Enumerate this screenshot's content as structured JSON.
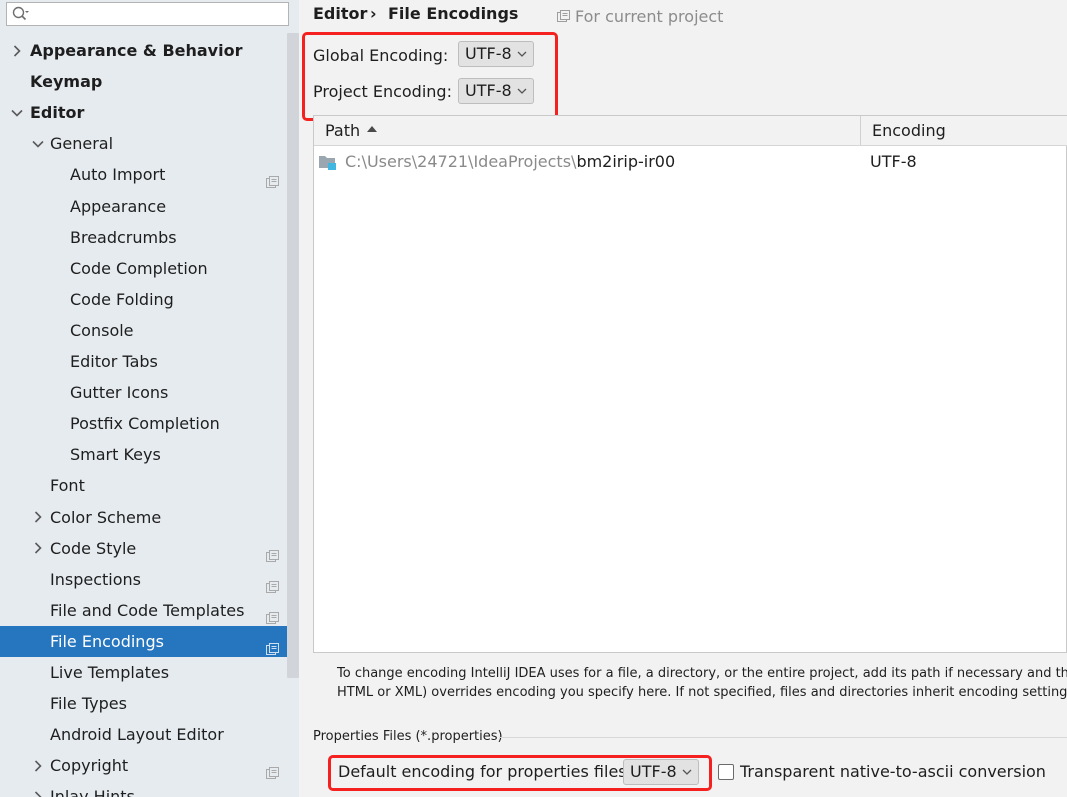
{
  "search": {
    "placeholder": ""
  },
  "tree": [
    {
      "label": "Appearance & Behavior",
      "level": 0,
      "bold": true,
      "chevron": "right"
    },
    {
      "label": "Keymap",
      "level": 0,
      "bold": true,
      "chevron": "none"
    },
    {
      "label": "Editor",
      "level": 0,
      "bold": true,
      "chevron": "down"
    },
    {
      "label": "General",
      "level": 1,
      "chevron": "down"
    },
    {
      "label": "Auto Import",
      "level": 2,
      "project_icon": true
    },
    {
      "label": "Appearance",
      "level": 2
    },
    {
      "label": "Breadcrumbs",
      "level": 2
    },
    {
      "label": "Code Completion",
      "level": 2
    },
    {
      "label": "Code Folding",
      "level": 2
    },
    {
      "label": "Console",
      "level": 2
    },
    {
      "label": "Editor Tabs",
      "level": 2
    },
    {
      "label": "Gutter Icons",
      "level": 2
    },
    {
      "label": "Postfix Completion",
      "level": 2
    },
    {
      "label": "Smart Keys",
      "level": 2
    },
    {
      "label": "Font",
      "level": 1
    },
    {
      "label": "Color Scheme",
      "level": 1,
      "chevron": "right"
    },
    {
      "label": "Code Style",
      "level": 1,
      "chevron": "right",
      "project_icon": true
    },
    {
      "label": "Inspections",
      "level": 1,
      "project_icon": true
    },
    {
      "label": "File and Code Templates",
      "level": 1,
      "project_icon": true
    },
    {
      "label": "File Encodings",
      "level": 1,
      "selected": true,
      "project_icon": true
    },
    {
      "label": "Live Templates",
      "level": 1
    },
    {
      "label": "File Types",
      "level": 1
    },
    {
      "label": "Android Layout Editor",
      "level": 1
    },
    {
      "label": "Copyright",
      "level": 1,
      "chevron": "right",
      "project_icon": true
    },
    {
      "label": "Inlay Hints",
      "level": 1,
      "chevron": "right",
      "project_icon": true
    }
  ],
  "breadcrumb": {
    "parent": "Editor",
    "separator": "›",
    "current": "File Encodings"
  },
  "scope_note": "For current project",
  "global_encoding": {
    "label": "Global Encoding:",
    "value": "UTF-8"
  },
  "project_encoding": {
    "label": "Project Encoding:",
    "value": "UTF-8"
  },
  "table": {
    "columns": [
      "Path",
      "Encoding"
    ],
    "rows": [
      {
        "path_prefix": "C:\\Users\\24721\\IdeaProjects\\",
        "path_name": "bm2irip-ir00",
        "encoding": "UTF-8"
      }
    ]
  },
  "hint": {
    "line1": "To change encoding IntelliJ IDEA uses for a file, a directory, or the entire project, add its path if necessary and then sele",
    "line2": "HTML or XML) overrides encoding you specify here. If not specified, files and directories inherit encoding settings from"
  },
  "properties": {
    "section_title": "Properties Files (*.properties)",
    "default_label": "Default encoding for properties files:",
    "default_value": "UTF-8",
    "transparent_label": "Transparent native-to-ascii conversion",
    "transparent_checked": false
  },
  "colors": {
    "selection": "#2675bf",
    "highlight_box": "#f52020",
    "sidebar_bg": "#e6ebf0"
  }
}
